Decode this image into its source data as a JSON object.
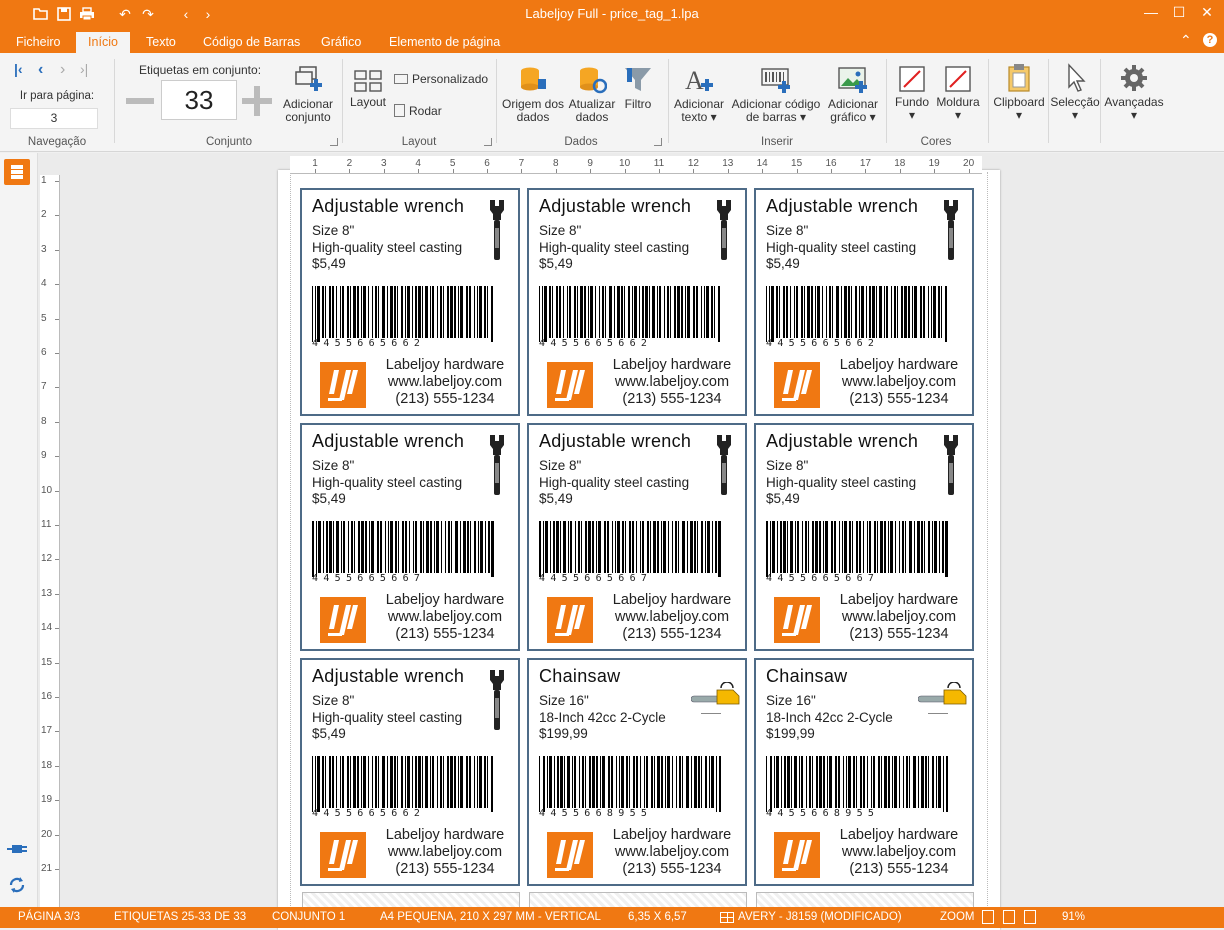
{
  "titlebar": {
    "title": "Labeljoy Full - price_tag_1.lpa"
  },
  "tabs": [
    {
      "label": "Ficheiro"
    },
    {
      "label": "Início"
    },
    {
      "label": "Texto"
    },
    {
      "label": "Código de Barras"
    },
    {
      "label": "Gráfico"
    },
    {
      "label": "Elemento de página"
    }
  ],
  "ribbon": {
    "navegacao": {
      "goto_label": "Ir para página:",
      "page_value": "3",
      "group": "Navegação"
    },
    "conjunto": {
      "count_label": "Etiquetas em conjunto:",
      "count_value": "33",
      "add_label": "Adicionar conjunto",
      "group": "Conjunto"
    },
    "layout": {
      "layout_label": "Layout",
      "custom_label": "Personalizado",
      "rotate_label": "Rodar",
      "group": "Layout"
    },
    "dados": {
      "source_label": "Origem dos dados",
      "refresh_label": "Atualizar dados",
      "filter_label": "Filtro",
      "group": "Dados"
    },
    "inserir": {
      "text_label": "Adicionar texto",
      "barcode_label": "Adicionar código de barras",
      "graphic_label": "Adicionar gráfico",
      "group": "Inserir"
    },
    "cores": {
      "fill_label": "Fundo",
      "border_label": "Moldura",
      "group": "Cores"
    },
    "clipboard_label": "Clipboard",
    "selection_label": "Selecção",
    "advanced_label": "Avançadas"
  },
  "ruler": {
    "h": [
      "1",
      "2",
      "3",
      "4",
      "5",
      "6",
      "7",
      "8",
      "9",
      "10",
      "11",
      "12",
      "13",
      "14",
      "15",
      "16",
      "17",
      "18",
      "19",
      "20"
    ],
    "v": [
      "1",
      "2",
      "3",
      "4",
      "5",
      "6",
      "7",
      "8",
      "9",
      "10",
      "11",
      "12",
      "13",
      "14",
      "15",
      "16",
      "17",
      "18",
      "19",
      "20",
      "21"
    ]
  },
  "labels": [
    {
      "title": "Adjustable wrench",
      "line1": "Size 8\"",
      "line2": "High-quality steel casting",
      "price": "$5,49",
      "barcode": "4455665662",
      "brand": "Labeljoy hardware",
      "web": "www.labeljoy.com",
      "phone": "(213) 555-1234",
      "picture": "wrench"
    },
    {
      "title": "Adjustable wrench",
      "line1": "Size 8\"",
      "line2": "High-quality steel casting",
      "price": "$5,49",
      "barcode": "4455665662",
      "brand": "Labeljoy hardware",
      "web": "www.labeljoy.com",
      "phone": "(213) 555-1234",
      "picture": "wrench"
    },
    {
      "title": "Adjustable wrench",
      "line1": "Size 8\"",
      "line2": "High-quality steel casting",
      "price": "$5,49",
      "barcode": "4455665662",
      "brand": "Labeljoy hardware",
      "web": "www.labeljoy.com",
      "phone": "(213) 555-1234",
      "picture": "wrench"
    },
    {
      "title": "Adjustable wrench",
      "line1": "Size 8\"",
      "line2": "High-quality steel casting",
      "price": "$5,49",
      "barcode": "4455665667",
      "brand": "Labeljoy hardware",
      "web": "www.labeljoy.com",
      "phone": "(213) 555-1234",
      "picture": "wrench"
    },
    {
      "title": "Adjustable wrench",
      "line1": "Size 8\"",
      "line2": "High-quality steel casting",
      "price": "$5,49",
      "barcode": "4455665667",
      "brand": "Labeljoy hardware",
      "web": "www.labeljoy.com",
      "phone": "(213) 555-1234",
      "picture": "wrench"
    },
    {
      "title": "Adjustable wrench",
      "line1": "Size 8\"",
      "line2": "High-quality steel casting",
      "price": "$5,49",
      "barcode": "4455665667",
      "brand": "Labeljoy hardware",
      "web": "www.labeljoy.com",
      "phone": "(213) 555-1234",
      "picture": "wrench"
    },
    {
      "title": "Adjustable wrench",
      "line1": "Size 8\"",
      "line2": "High-quality steel casting",
      "price": "$5,49",
      "barcode": "4455665662",
      "brand": "Labeljoy hardware",
      "web": "www.labeljoy.com",
      "phone": "(213) 555-1234",
      "picture": "wrench"
    },
    {
      "title": "Chainsaw",
      "line1": "Size 16\"",
      "line2": "18-Inch 42cc 2-Cycle",
      "price": "$199,99",
      "barcode": "4455668955",
      "brand": "Labeljoy hardware",
      "web": "www.labeljoy.com",
      "phone": "(213) 555-1234",
      "picture": "chainsaw"
    },
    {
      "title": "Chainsaw",
      "line1": "Size 16\"",
      "line2": "18-Inch 42cc 2-Cycle",
      "price": "$199,99",
      "barcode": "4455668955",
      "brand": "Labeljoy hardware",
      "web": "www.labeljoy.com",
      "phone": "(213) 555-1234",
      "picture": "chainsaw"
    }
  ],
  "statusbar": {
    "page": "PÁGINA 3/3",
    "labels": "ETIQUETAS 25-33 DE 33",
    "set": "CONJUNTO 1",
    "paper": "A4 PEQUENA, 210 X 297 MM - VERTICAL",
    "size": "6,35 X 6,57",
    "template": "AVERY - J8159 (MODIFICADO)",
    "zoom_label": "ZOOM",
    "zoom_value": "91%"
  },
  "colors": {
    "accent": "#f07812",
    "label_border": "#4e6b87"
  }
}
